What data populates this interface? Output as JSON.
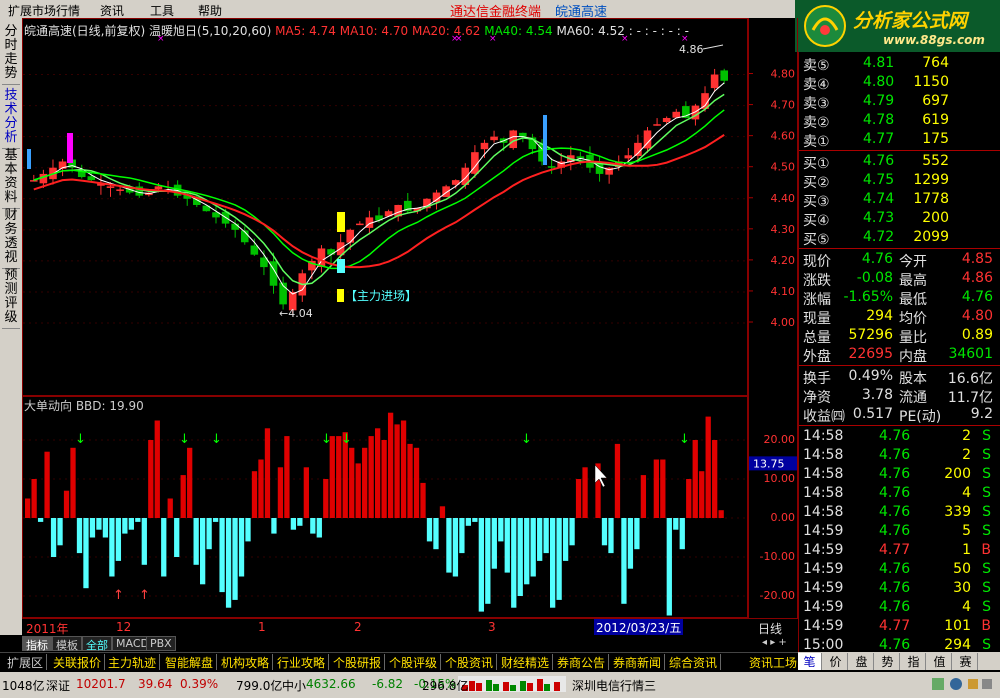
{
  "menu": {
    "items": [
      "扩展市场行情",
      "资讯",
      "工具",
      "帮助"
    ],
    "brand_a": "通达信金融终端",
    "brand_b": "皖通高速"
  },
  "logo": {
    "text": "分析家公式网",
    "url": "www.88gs.com"
  },
  "vtabs": [
    "分时走势",
    "技术分析",
    "基本资料",
    "财务透视",
    "预测评级"
  ],
  "chart_title": {
    "stock": "皖通高速(日线,前复权)",
    "indicator": "温暖旭日(5,10,20,60)",
    "ma5": "MA5: 4.74",
    "ma10": "MA10: 4.70",
    "ma20": "MA20: 4.62",
    "ma40": "MA40: 4.54",
    "ma60": "MA60: 4.52",
    "extra": ": - : - : - : -"
  },
  "annotations": {
    "high": "4.86",
    "low": "4.04",
    "signal": "【主力进场】"
  },
  "price_axis": [
    "4.80",
    "4.70",
    "4.60",
    "4.50",
    "4.40",
    "4.30",
    "4.20",
    "4.10",
    "4.00"
  ],
  "indicator": {
    "title": "大单动向 BBD: 19.90",
    "axis": [
      "20.00",
      "10.00",
      "0.00",
      "-10.00",
      "-20.00"
    ],
    "current": "13.75"
  },
  "xaxis": {
    "labels": [
      "2011年",
      "12",
      "1",
      "2",
      "3"
    ],
    "cursor_date": "2012/03/23/五",
    "period": "日线"
  },
  "chart_data": {
    "type": "candlestick",
    "price_range": [
      4.0,
      4.85
    ],
    "close_trend": [
      4.46,
      4.48,
      4.5,
      4.52,
      4.5,
      4.47,
      4.46,
      4.45,
      4.44,
      4.43,
      4.42,
      4.41,
      4.42,
      4.44,
      4.43,
      4.41,
      4.4,
      4.38,
      4.36,
      4.34,
      4.32,
      4.3,
      4.26,
      4.22,
      4.18,
      4.12,
      4.06,
      4.1,
      4.16,
      4.2,
      4.24,
      4.22,
      4.26,
      4.3,
      4.32,
      4.34,
      4.33,
      4.36,
      4.38,
      4.36,
      4.37,
      4.4,
      4.42,
      4.44,
      4.46,
      4.5,
      4.55,
      4.58,
      4.6,
      4.58,
      4.62,
      4.6,
      4.56,
      4.52,
      4.5,
      4.52,
      4.54,
      4.53,
      4.5,
      4.48,
      4.5,
      4.52,
      4.54,
      4.58,
      4.62,
      4.64,
      4.66,
      4.68,
      4.66,
      4.7,
      4.74,
      4.8,
      4.78
    ],
    "bbd_values": [
      5,
      10,
      -1,
      17,
      -10,
      -7,
      7,
      18,
      -9,
      -18,
      -5,
      -3,
      -5,
      -15,
      -11,
      -4,
      -3,
      -1,
      -12,
      20,
      25,
      -15,
      5,
      -10,
      11,
      18,
      -12,
      -17,
      -8,
      -1,
      -19,
      -23,
      -21,
      -15,
      -6,
      12,
      15,
      23,
      -4,
      13,
      21,
      -3,
      -2,
      13,
      -4,
      -5,
      10,
      21,
      21,
      22,
      18,
      14,
      18,
      21,
      23,
      20,
      27,
      24,
      25,
      19,
      18,
      9,
      -6,
      -8,
      3,
      -14,
      -15,
      -9,
      -2,
      -1,
      -24,
      -22,
      -13,
      -6,
      -14,
      -23,
      -20,
      -17,
      -15,
      -11,
      -9,
      -23,
      -21,
      -11,
      -7,
      10,
      13,
      0,
      14,
      -7,
      -9,
      19,
      -22,
      -13,
      -8,
      11,
      0,
      15,
      15,
      -25,
      -3,
      -8,
      10,
      20,
      12,
      26,
      20,
      2
    ]
  },
  "quotes": {
    "sell": [
      {
        "label": "卖⑤",
        "price": "4.81",
        "vol": "764"
      },
      {
        "label": "卖④",
        "price": "4.80",
        "vol": "1150"
      },
      {
        "label": "卖③",
        "price": "4.79",
        "vol": "697"
      },
      {
        "label": "卖②",
        "price": "4.78",
        "vol": "619"
      },
      {
        "label": "卖①",
        "price": "4.77",
        "vol": "175"
      }
    ],
    "buy": [
      {
        "label": "买①",
        "price": "4.76",
        "vol": "552"
      },
      {
        "label": "买②",
        "price": "4.75",
        "vol": "1299"
      },
      {
        "label": "买③",
        "price": "4.74",
        "vol": "1778"
      },
      {
        "label": "买④",
        "price": "4.73",
        "vol": "200"
      },
      {
        "label": "买⑤",
        "price": "4.72",
        "vol": "2099"
      }
    ],
    "stats": [
      {
        "l1": "现价",
        "v1": "4.76",
        "l2": "今开",
        "v2": "4.85",
        "c1": "green",
        "c2": "red"
      },
      {
        "l1": "涨跌",
        "v1": "-0.08",
        "l2": "最高",
        "v2": "4.86",
        "c1": "green",
        "c2": "red"
      },
      {
        "l1": "涨幅",
        "v1": "-1.65%",
        "l2": "最低",
        "v2": "4.76",
        "c1": "green",
        "c2": "green"
      },
      {
        "l1": "现量",
        "v1": "294",
        "l2": "均价",
        "v2": "4.80",
        "c1": "yellow",
        "c2": "red"
      },
      {
        "l1": "总量",
        "v1": "57296",
        "l2": "量比",
        "v2": "0.89",
        "c1": "yellow",
        "c2": "yellow"
      },
      {
        "l1": "外盘",
        "v1": "22695",
        "l2": "内盘",
        "v2": "34601",
        "c1": "red",
        "c2": "green"
      }
    ],
    "fund": [
      {
        "l1": "换手",
        "v1": "0.49%",
        "l2": "股本",
        "v2": "16.6亿"
      },
      {
        "l1": "净资",
        "v1": "3.78",
        "l2": "流通",
        "v2": "11.7亿"
      },
      {
        "l1": "收益㈣",
        "v1": "0.517",
        "l2": "PE(动)",
        "v2": "9.2"
      }
    ],
    "ticks": [
      {
        "t": "14:58",
        "p": "4.76",
        "v": "2",
        "f": "S"
      },
      {
        "t": "14:58",
        "p": "4.76",
        "v": "2",
        "f": "S"
      },
      {
        "t": "14:58",
        "p": "4.76",
        "v": "200",
        "f": "S"
      },
      {
        "t": "14:58",
        "p": "4.76",
        "v": "4",
        "f": "S"
      },
      {
        "t": "14:58",
        "p": "4.76",
        "v": "339",
        "f": "S"
      },
      {
        "t": "14:59",
        "p": "4.76",
        "v": "5",
        "f": "S"
      },
      {
        "t": "14:59",
        "p": "4.77",
        "v": "1",
        "f": "B"
      },
      {
        "t": "14:59",
        "p": "4.76",
        "v": "50",
        "f": "S"
      },
      {
        "t": "14:59",
        "p": "4.76",
        "v": "30",
        "f": "S"
      },
      {
        "t": "14:59",
        "p": "4.76",
        "v": "4",
        "f": "S"
      },
      {
        "t": "14:59",
        "p": "4.77",
        "v": "101",
        "f": "B"
      },
      {
        "t": "15:00",
        "p": "4.76",
        "v": "294",
        "f": "S"
      }
    ]
  },
  "subtabs": [
    "指标",
    "模板",
    "全部",
    "MACD",
    "PBX"
  ],
  "toolbar2": [
    "扩展区",
    "关联报价",
    "主力轨迹",
    "智能解盘",
    "机构攻略",
    "行业攻略",
    "个股研报",
    "个股评级",
    "个股资讯",
    "财经精选",
    "券商公告",
    "券商新闻",
    "综合资讯",
    "资讯工场"
  ],
  "ticktabs": [
    "笔",
    "价",
    "盘",
    "势",
    "指",
    "值",
    "赛"
  ],
  "status": {
    "s1": "1048亿",
    "s2": "深证",
    "s3": "10201.7",
    "s4": "39.64",
    "s5": "0.39%",
    "s6": "799.0亿",
    "s7": "中小",
    "s8": "4632.66",
    "s9": "-6.82",
    "s10": "-0.15%",
    "s11": "296.8亿",
    "s12": "深圳电信行情三"
  }
}
